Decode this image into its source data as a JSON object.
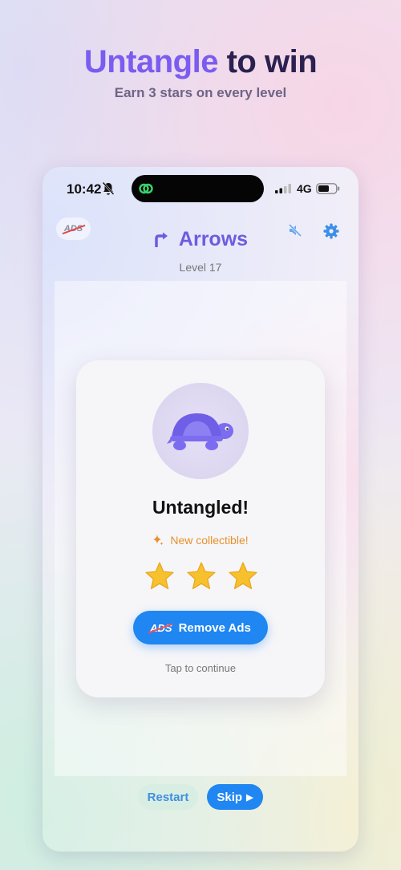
{
  "promo": {
    "title_accent": "Untangle",
    "title_rest": " to win",
    "subtitle": "Earn 3 stars on every level"
  },
  "status_bar": {
    "time": "10:42",
    "network": "4G"
  },
  "header": {
    "ads_badge": "ADS",
    "title": "Arrows",
    "level": "Level 17"
  },
  "result_card": {
    "title": "Untangled!",
    "collectible": "New collectible!",
    "stars_earned": 3,
    "stars_total": 3,
    "remove_ads_badge": "ADS",
    "remove_ads_label": "Remove Ads",
    "tap_hint": "Tap to continue"
  },
  "footer": {
    "restart_label": "Restart",
    "skip_label": "Skip"
  },
  "colors": {
    "accent": "#7b5cf0",
    "primary_button": "#1f86f2",
    "star": "#f7c02d",
    "collectible_text": "#e8902c"
  },
  "icons": [
    "bell-off-icon",
    "link-icon",
    "signal-icon",
    "battery-icon",
    "turn-arrow-icon",
    "mute-icon",
    "gear-icon",
    "turtle-icon",
    "sparkle-icon",
    "star-icon",
    "play-icon"
  ]
}
